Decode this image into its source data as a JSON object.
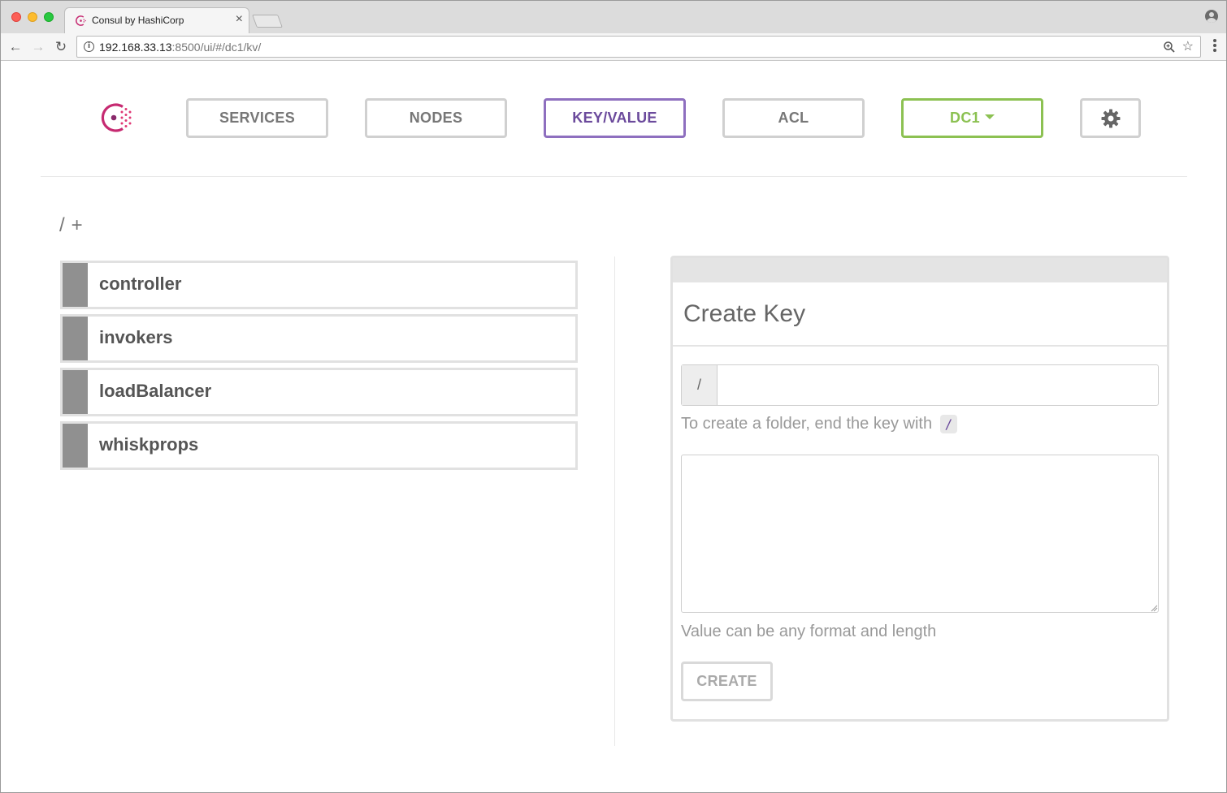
{
  "browser": {
    "tab_title": "Consul by HashiCorp",
    "tab_close": "×",
    "url_host": "192.168.33.13",
    "url_rest": ":8500/ui/#/dc1/kv/"
  },
  "nav": {
    "services": "SERVICES",
    "nodes": "NODES",
    "key_value": "KEY/VALUE",
    "acl": "ACL",
    "datacenter": "DC1"
  },
  "colors": {
    "active_accent": "#8e6fbf",
    "datacenter_accent": "#8cc152",
    "logo": "#c62a71"
  },
  "breadcrumb": {
    "root": "/",
    "add": "+"
  },
  "keys": [
    {
      "label": "controller"
    },
    {
      "label": "invokers"
    },
    {
      "label": "loadBalancer"
    },
    {
      "label": "whiskprops"
    }
  ],
  "create_key": {
    "title": "Create Key",
    "prefix": "/",
    "key_value": "",
    "folder_help": "To create a folder, end the key with",
    "folder_help_code": "/",
    "value": "",
    "value_help": "Value can be any format and length",
    "button": "CREATE"
  }
}
